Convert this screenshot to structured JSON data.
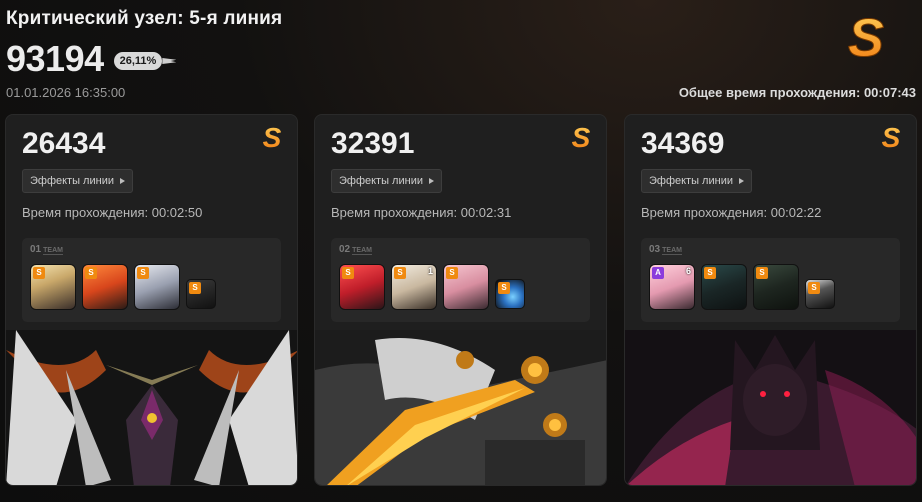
{
  "header": {
    "title": "Критический узел: 5-я линия",
    "total_score": "93194",
    "percent": "26,11%",
    "datetime": "01.01.2026 16:35:00",
    "total_time": "Общее время прохождения: 00:07:43",
    "rank": "S"
  },
  "colors": {
    "rank_gradient_top": "#ffd15a",
    "rank_gradient_bottom": "#f07a10",
    "accent": "#f08a10"
  },
  "cards": [
    {
      "score": "26434",
      "rank": "S",
      "effects_label": "Эффекты линии",
      "pass_time": "Время прохождения: 00:02:50",
      "team_no": "01",
      "team_word": "TEAM",
      "members": [
        {
          "badge": "S",
          "level": "",
          "name": "blonde-girl-avatar"
        },
        {
          "badge": "S",
          "level": "",
          "name": "orange-hair-girl-avatar"
        },
        {
          "badge": "S",
          "level": "",
          "name": "silver-hair-girl-avatar"
        },
        {
          "badge": "S",
          "level": "",
          "name": "support-unit-avatar"
        }
      ]
    },
    {
      "score": "32391",
      "rank": "S",
      "effects_label": "Эффекты линии",
      "pass_time": "Время прохождения: 00:02:31",
      "team_no": "02",
      "team_word": "TEAM",
      "members": [
        {
          "badge": "S",
          "level": "",
          "name": "red-hair-girl-avatar"
        },
        {
          "badge": "S",
          "level": "1",
          "name": "white-hair-girl-avatar"
        },
        {
          "badge": "S",
          "level": "",
          "name": "pink-hair-glasses-avatar"
        },
        {
          "badge": "S",
          "level": "",
          "name": "blue-slime-avatar"
        }
      ]
    },
    {
      "score": "34369",
      "rank": "S",
      "effects_label": "Эффекты линии",
      "pass_time": "Время прохождения: 00:02:22",
      "team_no": "03",
      "team_word": "TEAM",
      "members": [
        {
          "badge": "A",
          "level": "6",
          "name": "pink-hair-girl-avatar"
        },
        {
          "badge": "S",
          "level": "",
          "name": "dark-hair-maid-avatar"
        },
        {
          "badge": "S",
          "level": "",
          "name": "dark-hair-girl-avatar"
        },
        {
          "badge": "S",
          "level": "",
          "name": "robot-unit-avatar"
        }
      ]
    }
  ]
}
